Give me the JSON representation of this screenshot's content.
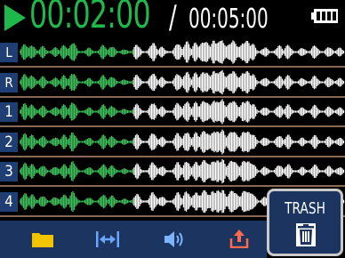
{
  "header": {
    "elapsed": "00:02:00",
    "separator": "/",
    "total": "00:05:00"
  },
  "tracks": [
    {
      "label": "L"
    },
    {
      "label": "R"
    },
    {
      "label": "1"
    },
    {
      "label": "2"
    },
    {
      "label": "3"
    },
    {
      "label": "4"
    }
  ],
  "colors": {
    "played_wave": "#3fbe5a",
    "unplayed_wave": "#ffffff",
    "accent_green": "#1fb84a",
    "bar_blue": "#1c3560"
  },
  "toolbar": {
    "icons": [
      "folder-icon",
      "trim-icon",
      "speaker-icon",
      "export-icon"
    ]
  },
  "trash": {
    "label": "TRASH",
    "icon": "trash-icon"
  }
}
